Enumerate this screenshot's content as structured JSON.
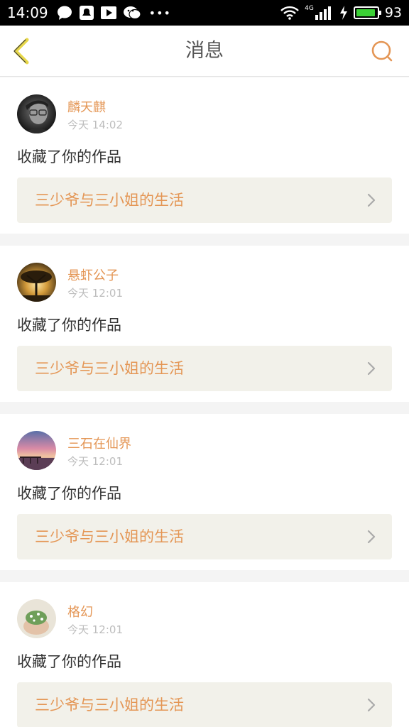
{
  "status_bar": {
    "time": "14:09",
    "network": "4G",
    "battery_level": "93",
    "battery_color": "#3bd135",
    "icons": [
      "chat-bubble-icon",
      "notification-icon",
      "video-icon",
      "wechat-icon",
      "more-dots-icon",
      "wifi-icon",
      "signal-icon",
      "charging-icon",
      "battery-icon"
    ]
  },
  "nav": {
    "title": "消息",
    "back_icon": "chevron-left-icon",
    "search_icon": "search-icon",
    "accent_color": "#e49655",
    "back_color": "#e8d84a"
  },
  "messages": [
    {
      "name": "麟天麒",
      "time": "今天 14:02",
      "action": "收藏了你的作品",
      "work_title": "三少爷与三小姐的生活"
    },
    {
      "name": "悬虾公子",
      "time": "今天 12:01",
      "action": "收藏了你的作品",
      "work_title": "三少爷与三小姐的生活"
    },
    {
      "name": "三石在仙界",
      "time": "今天 12:01",
      "action": "收藏了你的作品",
      "work_title": "三少爷与三小姐的生活"
    },
    {
      "name": "格幻",
      "time": "今天 12:01",
      "action": "收藏了你的作品",
      "work_title": "三少爷与三小姐的生活"
    }
  ]
}
